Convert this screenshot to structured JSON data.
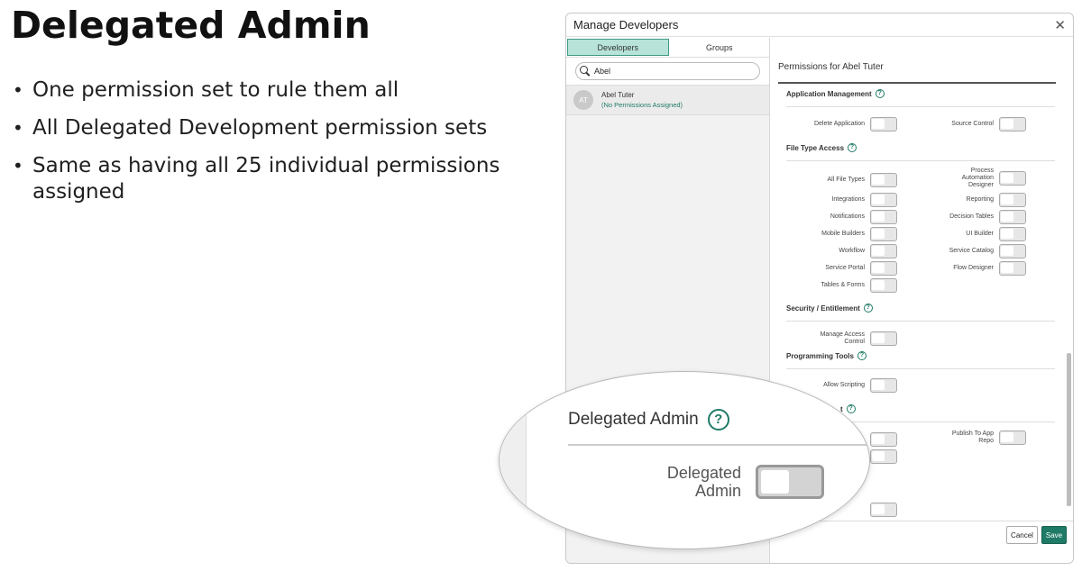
{
  "slide": {
    "title": "Delegated Admin",
    "bullets": [
      "One permission set to rule them all",
      "All Delegated Development permission sets",
      "Same as having all 25 individual permissions assigned"
    ]
  },
  "modal": {
    "title": "Manage Developers",
    "close_icon": "close-icon",
    "tabs": [
      {
        "label": "Developers",
        "active": true
      },
      {
        "label": "Groups",
        "active": false
      }
    ],
    "search": {
      "value": "Abel",
      "placeholder": "Search"
    },
    "user": {
      "initials": "AT",
      "name": "Abel Tuter",
      "status": "(No Permissions Assigned)"
    },
    "permissions_title": "Permissions for Abel Tuter",
    "sections": {
      "app_mgmt": {
        "title": "Application Management",
        "items": [
          "Delete Application",
          "Source Control"
        ]
      },
      "file_type": {
        "title": "File Type Access",
        "left": [
          "All File Types",
          "Integrations",
          "Notifications",
          "Mobile Builders",
          "Workflow",
          "Service Portal",
          "Tables & Forms"
        ],
        "right": [
          "Process Automation Designer",
          "Reporting",
          "Decision Tables",
          "UI Builder",
          "Service Catalog",
          "Flow Designer"
        ]
      },
      "security": {
        "title": "Security / Entitlement",
        "items": [
          "Manage Access Control"
        ]
      },
      "programming": {
        "title": "Programming Tools",
        "items": [
          "Allow Scripting"
        ]
      },
      "deployment": {
        "title_fragment": "t",
        "items": [
          "Publish To App Repo"
        ]
      }
    },
    "footer": {
      "cancel": "Cancel",
      "save": "Save"
    },
    "accent_color": "#1f7a66"
  },
  "magnifier": {
    "heading": "Delegated Admin",
    "toggle_label": "Delegated Admin"
  }
}
